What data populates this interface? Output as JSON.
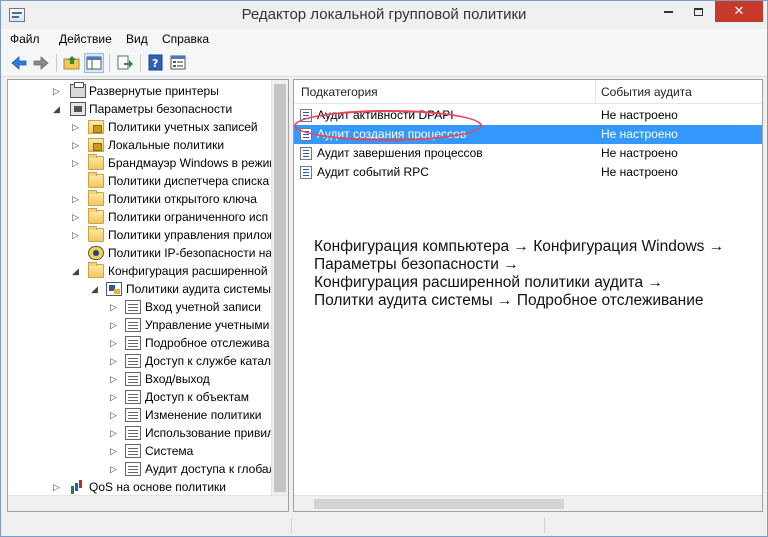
{
  "window": {
    "title": "Редактор локальной групповой политики"
  },
  "menu": [
    "Файл",
    "Действие",
    "Вид",
    "Справка"
  ],
  "tree": [
    {
      "label": "Развернутые принтеры",
      "icon": "printer-icon"
    },
    {
      "label": "Параметры безопасности",
      "icon": "security-settings-icon"
    },
    {
      "label": "Политики учетных записей",
      "icon": "lock-folder-icon"
    },
    {
      "label": "Локальные политики",
      "icon": "lock-folder-icon"
    },
    {
      "label": "Брандмауэр Windows в режим",
      "icon": "folder-icon"
    },
    {
      "label": "Политики диспетчера списка",
      "icon": "folder-icon"
    },
    {
      "label": "Политики открытого ключа",
      "icon": "folder-icon"
    },
    {
      "label": "Политики ограниченного исп",
      "icon": "folder-icon"
    },
    {
      "label": "Политики управления прилож",
      "icon": "folder-icon"
    },
    {
      "label": "Политики IP-безопасности на",
      "icon": "ipsec-icon"
    },
    {
      "label": "Конфигурация расширенной",
      "icon": "folder-icon"
    },
    {
      "label": "Политики аудита системы",
      "icon": "audit-icon"
    },
    {
      "label": "Вход учетной записи",
      "icon": "policy-icon"
    },
    {
      "label": "Управление учетными",
      "icon": "policy-icon"
    },
    {
      "label": "Подробное отслежива",
      "icon": "policy-icon"
    },
    {
      "label": "Доступ к службе катал",
      "icon": "policy-icon"
    },
    {
      "label": "Вход/выход",
      "icon": "policy-icon"
    },
    {
      "label": "Доступ к объектам",
      "icon": "policy-icon"
    },
    {
      "label": "Изменение политики",
      "icon": "policy-icon"
    },
    {
      "label": "Использование привил",
      "icon": "policy-icon"
    },
    {
      "label": "Система",
      "icon": "policy-icon"
    },
    {
      "label": "Аудит доступа к глобал",
      "icon": "policy-icon"
    },
    {
      "label": "QoS на основе политики",
      "icon": "qos-icon"
    }
  ],
  "list": {
    "columns": [
      "Подкатегория",
      "События аудита"
    ],
    "rows": [
      {
        "name": "Аудит активности DPAPI",
        "value": "Не настроено"
      },
      {
        "name": "Аудит создания процессов",
        "value": "Не настроено"
      },
      {
        "name": "Аудит завершения процессов",
        "value": "Не настроено"
      },
      {
        "name": "Аудит событий RPC",
        "value": "Не настроено"
      }
    ]
  },
  "annotation": [
    "Конфигурация компьютера → Конфигурация Windows →",
    "Параметры безопасности →",
    "Конфигурация расширенной политики аудита →",
    "Политки аудита системы → Подробное отслеживание"
  ],
  "colors": {
    "selection": "#3399ff",
    "highlight_ring": "#e8455a",
    "close_button": "#c7392b"
  }
}
